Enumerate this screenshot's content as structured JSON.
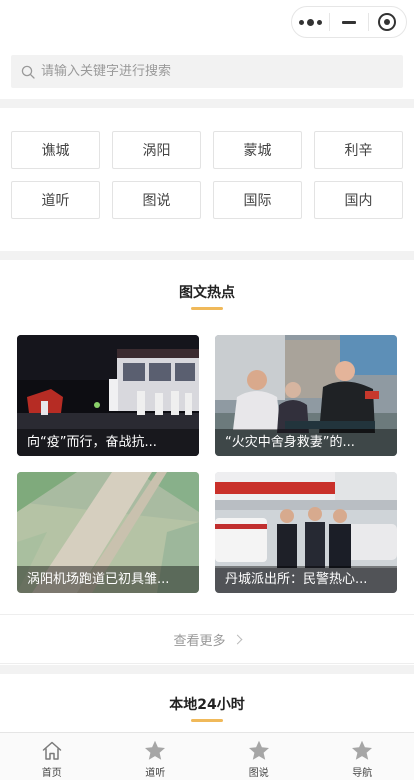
{
  "search": {
    "placeholder": "请输入关键字进行搜索"
  },
  "cities": [
    "谯城",
    "涡阳",
    "蒙城",
    "利辛",
    "道听",
    "图说",
    "国际",
    "国内"
  ],
  "hot_section": {
    "title": "图文热点",
    "accent": "#f0b95a"
  },
  "cards": [
    {
      "caption": "向“疫”而行，奋战抗..."
    },
    {
      "caption": "“火灾中舍身救妻”的..."
    },
    {
      "caption": "涡阳机场跑道已初具雏..."
    },
    {
      "caption": "丹城派出所：民警热心..."
    }
  ],
  "more": {
    "label": "查看更多"
  },
  "local_section": {
    "title": "本地24小时"
  },
  "tabs": [
    {
      "label": "首页",
      "icon": "home-icon"
    },
    {
      "label": "道听",
      "icon": "star-icon"
    },
    {
      "label": "图说",
      "icon": "star-icon"
    },
    {
      "label": "导航",
      "icon": "star-icon"
    }
  ]
}
